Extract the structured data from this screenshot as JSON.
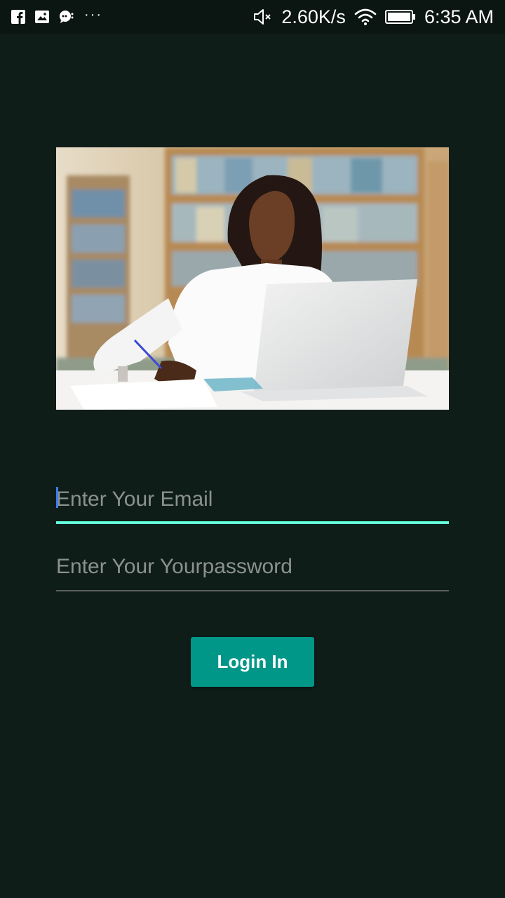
{
  "status_bar": {
    "speed": "2.60K/s",
    "time": "6:35 AM",
    "overflow_dots": "···",
    "icons": [
      "facebook-icon",
      "image-icon",
      "chat-icon",
      "mute-icon",
      "wifi-icon",
      "battery-icon"
    ]
  },
  "login_form": {
    "email_placeholder": "Enter Your Email",
    "password_placeholder": "Enter Your Yourpassword",
    "login_label": "Login In"
  },
  "colors": {
    "background": "#0f1d19",
    "accent_underline": "#64ffda",
    "button": "#009688"
  }
}
